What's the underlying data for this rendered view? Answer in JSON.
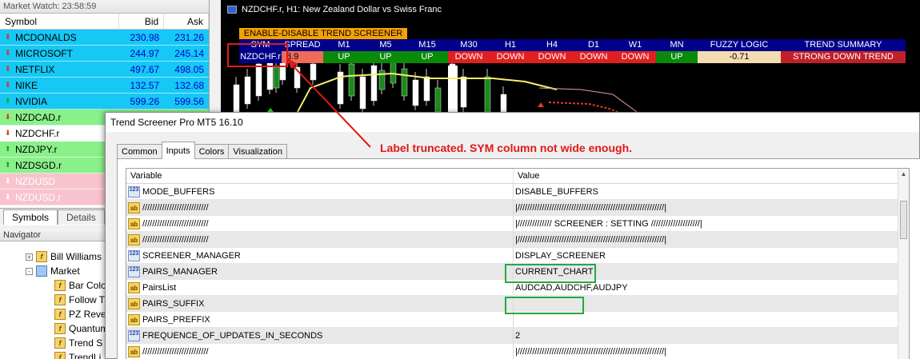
{
  "market_watch": {
    "title": "Market Watch: 23:58:59",
    "headers": {
      "symbol": "Symbol",
      "bid": "Bid",
      "ask": "Ask"
    },
    "rows": [
      {
        "symbol": "MCDONALDS",
        "bid": "230.98",
        "ask": "231.26",
        "color": "blue",
        "dir": "down"
      },
      {
        "symbol": "MICROSOFT",
        "bid": "244.97",
        "ask": "245.14",
        "color": "blue",
        "dir": "down"
      },
      {
        "symbol": "NETFLIX",
        "bid": "497.67",
        "ask": "498.05",
        "color": "blue",
        "dir": "down"
      },
      {
        "symbol": "NIKE",
        "bid": "132.57",
        "ask": "132.68",
        "color": "blue",
        "dir": "down"
      },
      {
        "symbol": "NVIDIA",
        "bid": "599.26",
        "ask": "599.56",
        "color": "blue",
        "dir": "up"
      },
      {
        "symbol": "NZDCAD.r",
        "bid": "",
        "ask": "",
        "color": "green",
        "dir": "down"
      },
      {
        "symbol": "NZDCHF.r",
        "bid": "",
        "ask": "",
        "color": "white",
        "dir": "down"
      },
      {
        "symbol": "NZDJPY.r",
        "bid": "",
        "ask": "",
        "color": "green",
        "dir": "up"
      },
      {
        "symbol": "NZDSGD.r",
        "bid": "",
        "ask": "",
        "color": "green",
        "dir": "up"
      },
      {
        "symbol": "NZDUSD",
        "bid": "",
        "ask": "",
        "color": "pink",
        "dir": "down"
      },
      {
        "symbol": "NZDUSD.r",
        "bid": "",
        "ask": "",
        "color": "pink",
        "dir": "down"
      }
    ],
    "tabs": [
      "Symbols",
      "Details"
    ],
    "active_tab": "Symbols"
  },
  "navigator": {
    "title": "Navigator",
    "items": [
      {
        "label": "Bill Williams",
        "kind": "indicator",
        "level": 1,
        "expander": "+"
      },
      {
        "label": "Market",
        "kind": "folder",
        "level": 1,
        "expander": "-"
      },
      {
        "label": "Bar Colo",
        "kind": "indicator",
        "level": 2
      },
      {
        "label": "Follow T",
        "kind": "indicator",
        "level": 2
      },
      {
        "label": "PZ Reve",
        "kind": "indicator",
        "level": 2
      },
      {
        "label": "Quantum",
        "kind": "indicator",
        "level": 2
      },
      {
        "label": "Trend S",
        "kind": "indicator",
        "level": 2
      },
      {
        "label": "TrendLi",
        "kind": "indicator",
        "level": 2
      }
    ]
  },
  "chart": {
    "title": "NZDCHF.r, H1:  New Zealand Dollar vs Swiss Franc",
    "enable_button": "ENABLE-DISABLE TREND SCREENER",
    "screener": {
      "headers": [
        "SYM",
        "SPREAD",
        "M1",
        "M5",
        "M15",
        "M30",
        "H1",
        "H4",
        "D1",
        "W1",
        "MN",
        "FUZZY LOGIC",
        "TREND SUMMARY"
      ],
      "row": {
        "sym": "NZDCHF.r",
        "spread": "8.9",
        "timeframes": [
          "UP",
          "UP",
          "UP",
          "DOWN",
          "DOWN",
          "DOWN",
          "DOWN",
          "DOWN",
          "UP"
        ],
        "fuzzy": "-0.71",
        "summary": "STRONG DOWN TREND"
      },
      "colors": {
        "header": "#00008b",
        "up": "#0a8a0a",
        "down": "#e02020",
        "summary": "#c0202a"
      }
    }
  },
  "dialog": {
    "title": "Trend Screener Pro MT5 16.10",
    "tabs": [
      "Common",
      "Inputs",
      "Colors",
      "Visualization"
    ],
    "active_tab": "Inputs",
    "grid": {
      "headers": {
        "variable": "Variable",
        "value": "Value"
      },
      "rows": [
        {
          "type": "123",
          "variable": "MODE_BUFFERS",
          "value": "DISABLE_BUFFERS"
        },
        {
          "type": "ab",
          "variable": "///////////////////////////",
          "value": "|////////////////////////////////////////////////////////////|"
        },
        {
          "type": "ab",
          "variable": "///////////////////////////",
          "value": "|////////////// SCREENER : SETTING ////////////////////|"
        },
        {
          "type": "ab",
          "variable": "///////////////////////////",
          "value": "|////////////////////////////////////////////////////////////|"
        },
        {
          "type": "123",
          "variable": "SCREENER_MANAGER",
          "value": "DISPLAY_SCREENER"
        },
        {
          "type": "123",
          "variable": "PAIRS_MANAGER",
          "value": "CURRENT_CHART"
        },
        {
          "type": "ab",
          "variable": "PairsList",
          "value": "AUDCAD,AUDCHF,AUDJPY"
        },
        {
          "type": "ab",
          "variable": "PAIRS_SUFFIX",
          "value": ""
        },
        {
          "type": "ab",
          "variable": "PAIRS_PREFFIX",
          "value": ""
        },
        {
          "type": "123",
          "variable": "FREQUENCE_OF_UPDATES_IN_SECONDS",
          "value": "2"
        },
        {
          "type": "ab",
          "variable": "///////////////////////////",
          "value": "|////////////////////////////////////////////////////////////|"
        }
      ]
    }
  },
  "annotation": {
    "text": "Label truncated. SYM column not wide enough.",
    "color": "#e01818",
    "box_color": "#22aa44"
  }
}
